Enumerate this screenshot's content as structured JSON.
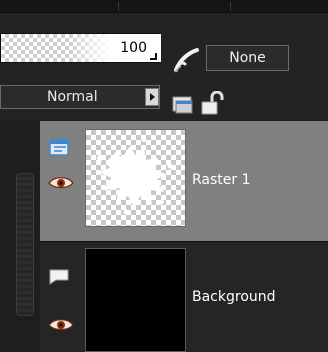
{
  "toolbar": {
    "opacity_value": "100",
    "link_mode": "None",
    "blend_mode": "Normal"
  },
  "icons": {
    "link": "link-brush-icon",
    "group": "layer-group-icon",
    "lock": "lock-icon",
    "visibility": "eye-icon"
  },
  "layers": [
    {
      "name": "Raster 1",
      "type": "raster",
      "selected": true
    },
    {
      "name": "Background",
      "type": "background",
      "selected": false
    }
  ],
  "colors": {
    "selected_row": "#808080",
    "accent_blue": "#3d88cc"
  }
}
